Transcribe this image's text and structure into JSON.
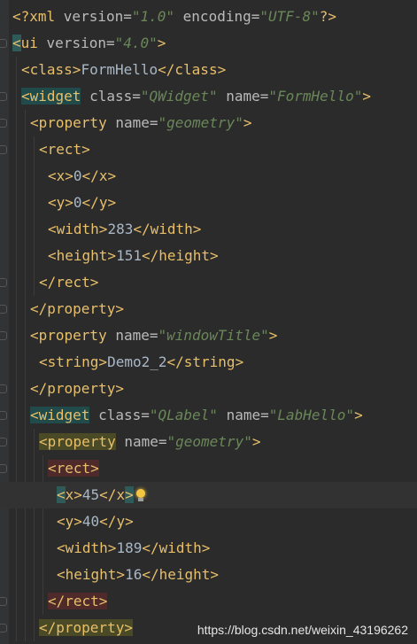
{
  "editor": {
    "lines": [
      {
        "indent": "",
        "parts": [
          {
            "c": "pi",
            "t": "<?xml "
          },
          {
            "c": "attr",
            "t": "version="
          },
          {
            "c": "val",
            "t": "\"1.0\""
          },
          {
            "c": "attr",
            "t": " encoding="
          },
          {
            "c": "val",
            "t": "\"UTF-8\""
          },
          {
            "c": "pi",
            "t": "?>"
          }
        ]
      },
      {
        "indent": "",
        "parts": [
          {
            "c": "tag hl-match",
            "t": "<"
          },
          {
            "c": "tag",
            "t": "ui "
          },
          {
            "c": "attr",
            "t": "version="
          },
          {
            "c": "val",
            "t": "\"4.0\""
          },
          {
            "c": "tag",
            "t": ">"
          }
        ]
      },
      {
        "indent": " ",
        "parts": [
          {
            "c": "tag",
            "t": "<class>"
          },
          {
            "c": "txt",
            "t": "FormHello"
          },
          {
            "c": "tag",
            "t": "</class>"
          }
        ]
      },
      {
        "indent": " ",
        "parts": [
          {
            "c": "tag hl-teal",
            "t": "<widget"
          },
          {
            "c": "attr",
            "t": " class="
          },
          {
            "c": "val",
            "t": "\"QWidget\""
          },
          {
            "c": "attr",
            "t": " name="
          },
          {
            "c": "val",
            "t": "\"FormHello\""
          },
          {
            "c": "tag",
            "t": ">"
          }
        ]
      },
      {
        "indent": "  ",
        "parts": [
          {
            "c": "tag",
            "t": "<property"
          },
          {
            "c": "attr",
            "t": " name="
          },
          {
            "c": "val",
            "t": "\"geometry\""
          },
          {
            "c": "tag",
            "t": ">"
          }
        ]
      },
      {
        "indent": "   ",
        "parts": [
          {
            "c": "tag",
            "t": "<rect>"
          }
        ]
      },
      {
        "indent": "    ",
        "parts": [
          {
            "c": "tag",
            "t": "<x>"
          },
          {
            "c": "txt",
            "t": "0"
          },
          {
            "c": "tag",
            "t": "</x>"
          }
        ]
      },
      {
        "indent": "    ",
        "parts": [
          {
            "c": "tag",
            "t": "<y>"
          },
          {
            "c": "txt",
            "t": "0"
          },
          {
            "c": "tag",
            "t": "</y>"
          }
        ]
      },
      {
        "indent": "    ",
        "parts": [
          {
            "c": "tag",
            "t": "<width>"
          },
          {
            "c": "txt",
            "t": "283"
          },
          {
            "c": "tag",
            "t": "</width>"
          }
        ]
      },
      {
        "indent": "    ",
        "parts": [
          {
            "c": "tag",
            "t": "<height>"
          },
          {
            "c": "txt",
            "t": "151"
          },
          {
            "c": "tag",
            "t": "</height>"
          }
        ]
      },
      {
        "indent": "   ",
        "parts": [
          {
            "c": "tag",
            "t": "</rect>"
          }
        ]
      },
      {
        "indent": "  ",
        "parts": [
          {
            "c": "tag",
            "t": "</property>"
          }
        ]
      },
      {
        "indent": "  ",
        "parts": [
          {
            "c": "tag",
            "t": "<property"
          },
          {
            "c": "attr",
            "t": " name="
          },
          {
            "c": "val",
            "t": "\"windowTitle\""
          },
          {
            "c": "tag",
            "t": ">"
          }
        ]
      },
      {
        "indent": "   ",
        "parts": [
          {
            "c": "tag",
            "t": "<string>"
          },
          {
            "c": "txt",
            "t": "Demo2_2"
          },
          {
            "c": "tag",
            "t": "</string>"
          }
        ]
      },
      {
        "indent": "  ",
        "parts": [
          {
            "c": "tag",
            "t": "</property>"
          }
        ]
      },
      {
        "indent": "  ",
        "parts": [
          {
            "c": "tag hl-teal",
            "t": "<widget"
          },
          {
            "c": "attr",
            "t": " class="
          },
          {
            "c": "val",
            "t": "\"QLabel\""
          },
          {
            "c": "attr",
            "t": " name="
          },
          {
            "c": "val",
            "t": "\"LabHello\""
          },
          {
            "c": "tag",
            "t": ">"
          }
        ]
      },
      {
        "indent": "   ",
        "parts": [
          {
            "c": "tag hl-olive",
            "t": "<property"
          },
          {
            "c": "attr",
            "t": " name="
          },
          {
            "c": "val",
            "t": "\"geometry\""
          },
          {
            "c": "tag",
            "t": ">"
          }
        ]
      },
      {
        "indent": "    ",
        "parts": [
          {
            "c": "tag hl-red",
            "t": "<rect>"
          }
        ]
      },
      {
        "indent": "     ",
        "caret": true,
        "parts": [
          {
            "c": "tag hl-match",
            "t": "<"
          },
          {
            "c": "tag",
            "t": "x>"
          },
          {
            "c": "txt",
            "t": "45"
          },
          {
            "c": "tag",
            "t": "</x"
          },
          {
            "c": "tag hl-match",
            "t": ">"
          }
        ],
        "bulb": true
      },
      {
        "indent": "     ",
        "parts": [
          {
            "c": "tag",
            "t": "<y>"
          },
          {
            "c": "txt",
            "t": "40"
          },
          {
            "c": "tag",
            "t": "</y>"
          }
        ]
      },
      {
        "indent": "     ",
        "parts": [
          {
            "c": "tag",
            "t": "<width>"
          },
          {
            "c": "txt",
            "t": "189"
          },
          {
            "c": "tag",
            "t": "</width>"
          }
        ]
      },
      {
        "indent": "     ",
        "parts": [
          {
            "c": "tag",
            "t": "<height>"
          },
          {
            "c": "txt",
            "t": "16"
          },
          {
            "c": "tag",
            "t": "</height>"
          }
        ]
      },
      {
        "indent": "    ",
        "parts": [
          {
            "c": "tag hl-red",
            "t": "</rect>"
          }
        ]
      },
      {
        "indent": "   ",
        "parts": [
          {
            "c": "tag hl-olive",
            "t": "</property>"
          }
        ]
      }
    ]
  },
  "watermark": "https://blog.csdn.net/weixin_43196262"
}
